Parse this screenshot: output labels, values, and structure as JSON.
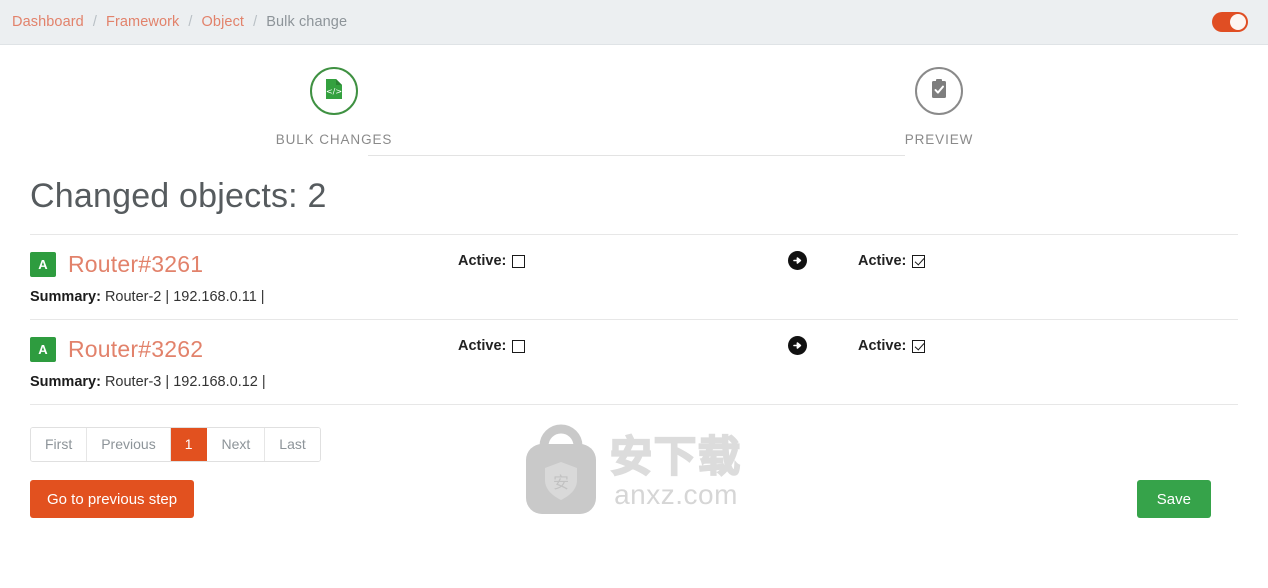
{
  "header": {
    "breadcrumb": [
      {
        "label": "Dashboard",
        "type": "link"
      },
      {
        "label": "Framework",
        "type": "link"
      },
      {
        "label": "Object",
        "type": "link"
      },
      {
        "label": "Bulk change",
        "type": "current"
      }
    ],
    "separator": "/",
    "toggle": {
      "name": "theme-toggle",
      "state": "on",
      "color": "#e04e23"
    }
  },
  "stepper": {
    "steps": [
      {
        "label": "BULK CHANGES",
        "icon": "file-code-icon",
        "state": "active",
        "color": "#3f9142"
      },
      {
        "label": "PREVIEW",
        "icon": "clipboard-check-icon",
        "state": "inactive",
        "color": "#8a8a8a"
      }
    ]
  },
  "main": {
    "title": "Changed objects: 2",
    "rows": [
      {
        "badge": "A",
        "link": "Router#3261",
        "old_label": "Active:",
        "old_checked": false,
        "arrow_icon": "arrow-circle-right-icon",
        "new_label": "Active:",
        "new_checked": true,
        "summary_label": "Summary:",
        "summary_value": "Router-2 | 192.168.0.11 |"
      },
      {
        "badge": "A",
        "link": "Router#3262",
        "old_label": "Active:",
        "old_checked": false,
        "arrow_icon": "arrow-circle-right-icon",
        "new_label": "Active:",
        "new_checked": true,
        "summary_label": "Summary:",
        "summary_value": "Router-3 | 192.168.0.12 |"
      }
    ],
    "pagination": [
      {
        "label": "First",
        "active": false
      },
      {
        "label": "Previous",
        "active": false
      },
      {
        "label": "1",
        "active": true
      },
      {
        "label": "Next",
        "active": false
      },
      {
        "label": "Last",
        "active": false
      }
    ],
    "buttons": {
      "previous_step": "Go to previous step",
      "save": "Save"
    },
    "colors": {
      "accent_orange": "#e2511f",
      "link_orange": "#e2826b",
      "green": "#36a34a",
      "badge_green": "#2e9c3f"
    }
  },
  "watermark": {
    "cn_text": "安下载",
    "url_text": "anxz.com",
    "logo_char": "安"
  }
}
